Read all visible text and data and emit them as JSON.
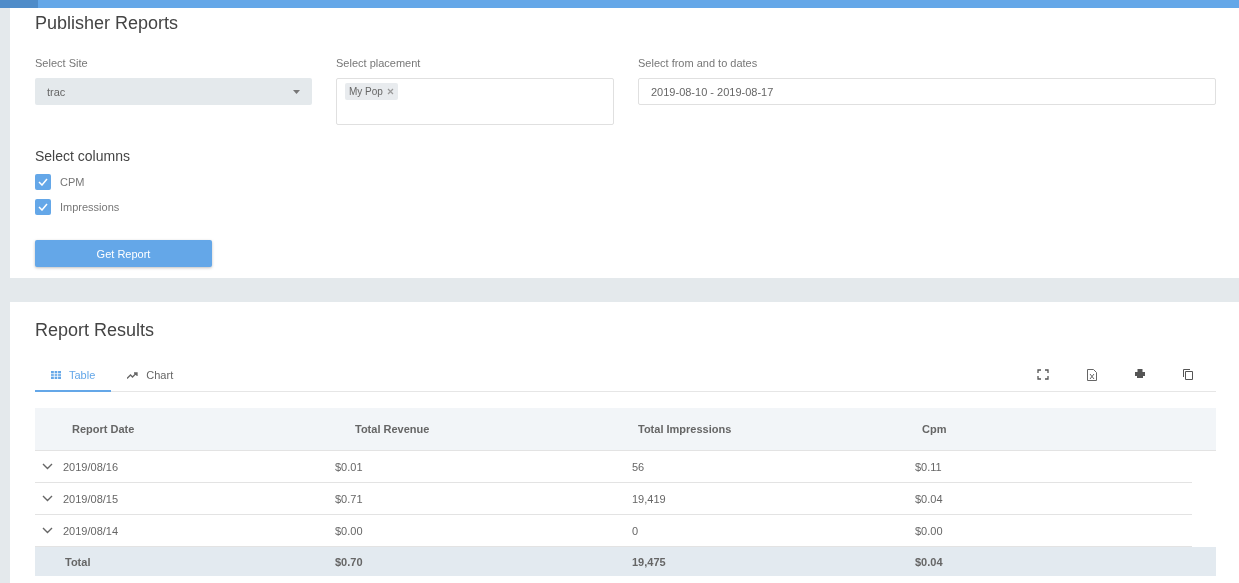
{
  "form": {
    "title": "Publisher Reports",
    "site": {
      "label": "Select Site",
      "value": "trac"
    },
    "placement": {
      "label": "Select placement",
      "tags": [
        "My Pop"
      ]
    },
    "dates": {
      "label": "Select from and to dates",
      "value": "2019-08-10 - 2019-08-17"
    },
    "columns_title": "Select columns",
    "options": [
      {
        "label": "CPM",
        "checked": true
      },
      {
        "label": "Impressions",
        "checked": true
      }
    ],
    "button": "Get Report"
  },
  "results": {
    "title": "Report Results",
    "tabs": [
      {
        "label": "Table",
        "selected": true
      },
      {
        "label": "Chart",
        "selected": false
      }
    ],
    "table": {
      "columns": [
        "Report Date",
        "Total Revenue",
        "Total Impressions",
        "Cpm"
      ],
      "rows": [
        [
          "2019/08/16",
          "$0.01",
          "56",
          "$0.11"
        ],
        [
          "2019/08/15",
          "$0.71",
          "19,419",
          "$0.04"
        ],
        [
          "2019/08/14",
          "$0.00",
          "0",
          "$0.00"
        ]
      ],
      "total": [
        "Total",
        "$0.70",
        "19,475",
        "$0.04"
      ]
    }
  }
}
